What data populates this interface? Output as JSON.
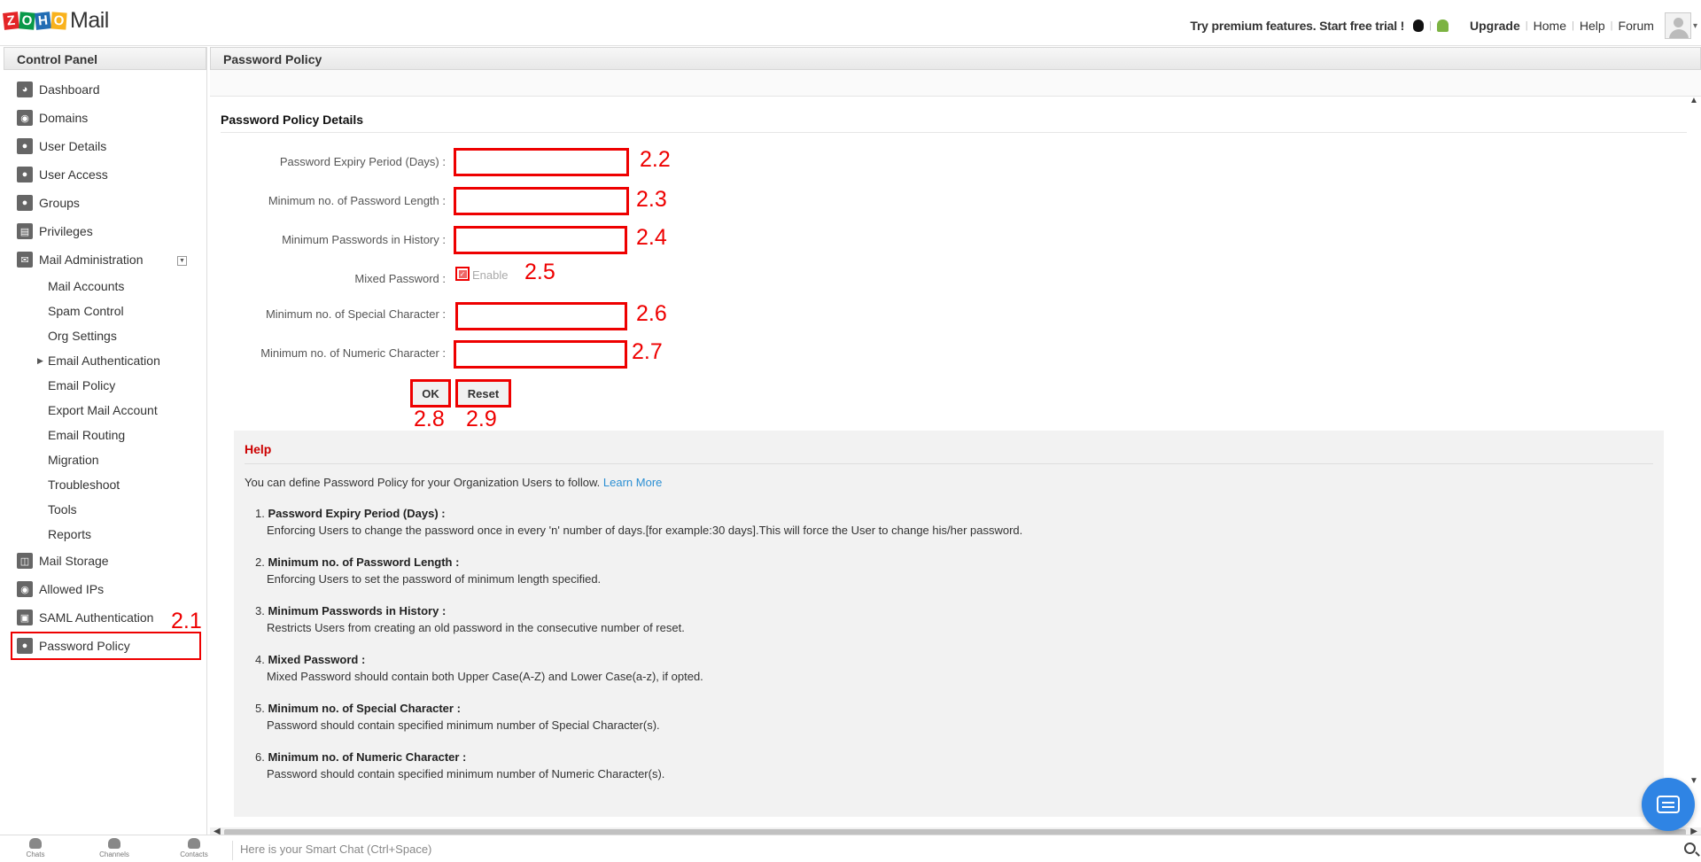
{
  "header": {
    "app_name": "Mail",
    "logo_letters": [
      "Z",
      "O",
      "H",
      "O"
    ],
    "promo": "Try premium features. Start free trial !",
    "upgrade": "Upgrade",
    "home": "Home",
    "help": "Help",
    "forum": "Forum"
  },
  "sidebar": {
    "title": "Control Panel",
    "items": [
      {
        "label": "Dashboard",
        "icon": "dashboard-icon"
      },
      {
        "label": "Domains",
        "icon": "domains-icon"
      },
      {
        "label": "User Details",
        "icon": "user-icon"
      },
      {
        "label": "User Access",
        "icon": "user-access-icon"
      },
      {
        "label": "Groups",
        "icon": "groups-icon"
      },
      {
        "label": "Privileges",
        "icon": "privileges-icon"
      },
      {
        "label": "Mail Administration",
        "icon": "mail-icon"
      },
      {
        "label": "Mail Accounts"
      },
      {
        "label": "Spam Control"
      },
      {
        "label": "Org Settings"
      },
      {
        "label": "Email Authentication"
      },
      {
        "label": "Email Policy"
      },
      {
        "label": "Export Mail Account"
      },
      {
        "label": "Email Routing"
      },
      {
        "label": "Migration"
      },
      {
        "label": "Troubleshoot"
      },
      {
        "label": "Tools"
      },
      {
        "label": "Reports"
      },
      {
        "label": "Mail Storage",
        "icon": "storage-icon"
      },
      {
        "label": "Allowed IPs",
        "icon": "allowed-ips-icon"
      },
      {
        "label": "SAML Authentication",
        "icon": "saml-icon"
      },
      {
        "label": "Password Policy",
        "icon": "lock-icon"
      }
    ]
  },
  "main": {
    "title": "Password Policy",
    "section_title": "Password Policy Details",
    "fields": {
      "expiry": {
        "label": "Password Expiry Period (Days) :",
        "value": ""
      },
      "min_length": {
        "label": "Minimum no. of Password Length :",
        "value": ""
      },
      "history": {
        "label": "Minimum Passwords in History :",
        "value": ""
      },
      "mixed": {
        "label": "Mixed Password :",
        "option": "Enable",
        "checked": true
      },
      "special": {
        "label": "Minimum no. of Special Character :",
        "value": ""
      },
      "numeric": {
        "label": "Minimum no. of Numeric Character :",
        "value": ""
      }
    },
    "buttons": {
      "ok": "OK",
      "reset": "Reset"
    }
  },
  "help": {
    "title": "Help",
    "intro": "You can define Password Policy for your Organization Users to follow.",
    "learn_more": "Learn More",
    "items": [
      {
        "num": "1.",
        "title": "Password Expiry Period (Days) :",
        "desc": "Enforcing Users to change the password once in every 'n' number of days.[for example:30 days].This will force the User to change his/her password."
      },
      {
        "num": "2.",
        "title": "Minimum no. of Password Length :",
        "desc": "Enforcing Users to set the password of minimum length specified."
      },
      {
        "num": "3.",
        "title": "Minimum Passwords in History :",
        "desc": "Restricts Users from creating an old password in the consecutive number of reset."
      },
      {
        "num": "4.",
        "title": "Mixed Password :",
        "desc": "Mixed Password should contain both Upper Case(A-Z) and Lower Case(a-z), if opted."
      },
      {
        "num": "5.",
        "title": "Minimum no. of Special Character :",
        "desc": "Password should contain specified minimum number of Special Character(s)."
      },
      {
        "num": "6.",
        "title": "Minimum no. of Numeric Character :",
        "desc": "Password should contain specified minimum number of Numeric Character(s)."
      }
    ]
  },
  "annotations": [
    "2.1",
    "2.2",
    "2.3",
    "2.4",
    "2.5",
    "2.6",
    "2.7",
    "2.8",
    "2.9"
  ],
  "bottom_bar": {
    "chats": "Chats",
    "channels": "Channels",
    "contacts": "Contacts",
    "smart_chat_placeholder": "Here is your Smart Chat (Ctrl+Space)"
  },
  "colors": {
    "annotation": "#e00000",
    "link": "#2b8fd3",
    "help_title": "#cc0000",
    "chat_bubble": "#2f84e4"
  }
}
